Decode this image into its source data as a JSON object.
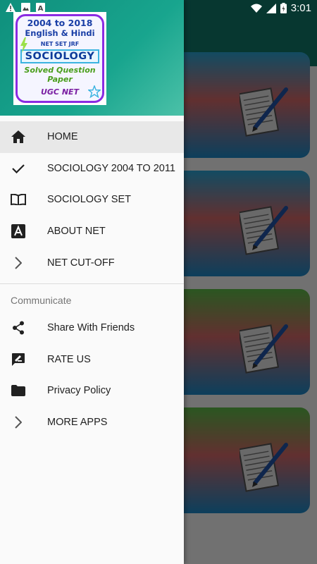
{
  "status_bar": {
    "time": "3:01",
    "left_icons": [
      "warning-icon",
      "image-icon",
      "app-a-icon"
    ],
    "right_icons": [
      "wifi-icon",
      "signal-icon",
      "battery-icon"
    ]
  },
  "drawer": {
    "logo": {
      "line1": "2004 to 2018",
      "line2": "English & Hindi",
      "line3": "NET SET JRF",
      "line4": "SOCIOLOGY",
      "line5": "Solved Question",
      "line6": "Paper",
      "line7": "UGC NET"
    },
    "menu": [
      {
        "label": "HOME",
        "icon": "home-icon",
        "active": true
      },
      {
        "label": "SOCIOLOGY 2004 TO 2011",
        "icon": "check-icon",
        "active": false
      },
      {
        "label": "SOCIOLOGY SET",
        "icon": "book-icon",
        "active": false
      },
      {
        "label": "ABOUT NET",
        "icon": "font-a-icon",
        "active": false
      },
      {
        "label": "NET CUT-OFF",
        "icon": "chevron-right-icon",
        "active": false
      }
    ],
    "section_title": "Communicate",
    "communicate": [
      {
        "label": "Share With Friends",
        "icon": "share-icon"
      },
      {
        "label": "RATE US",
        "icon": "rate-review-icon"
      },
      {
        "label": "Privacy Policy",
        "icon": "folder-icon"
      },
      {
        "label": "MORE APPS",
        "icon": "chevron-right-icon"
      }
    ]
  },
  "colors": {
    "header_teal": "#0f8f7c",
    "toolbar_teal": "#117a6c",
    "active_bg": "#e8e8e8",
    "text": "#212121",
    "section_text": "#757575"
  }
}
